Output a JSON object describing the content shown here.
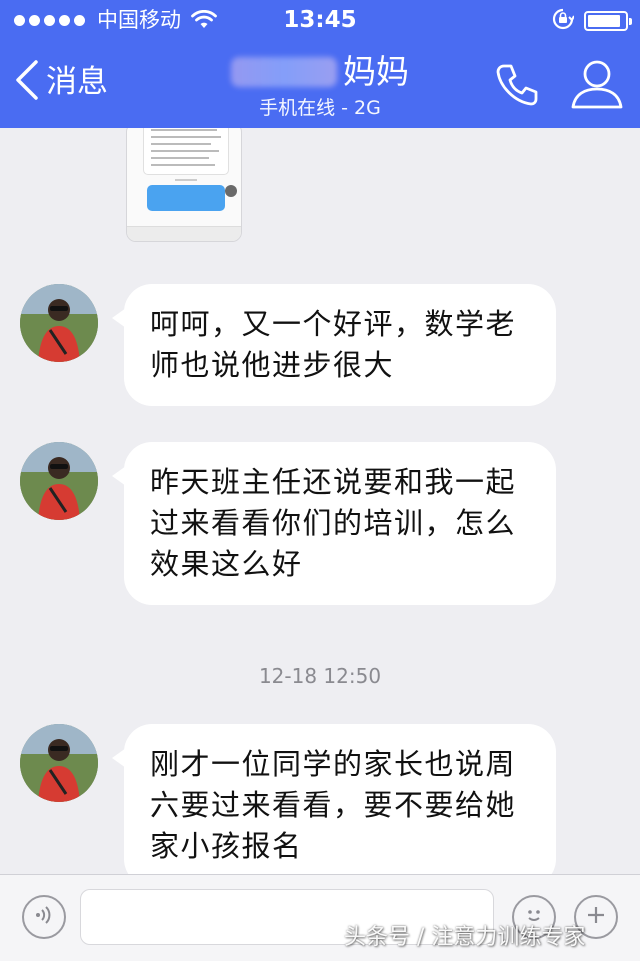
{
  "status_bar": {
    "carrier": "中国移动",
    "time": "13:45",
    "signal_icon": "signal-dots-icon",
    "wifi_icon": "wifi-icon",
    "orientation_icon": "rotation-lock-icon",
    "battery_icon": "battery-icon",
    "battery_level": 0.9
  },
  "nav": {
    "back_label": "消息",
    "back_icon": "chevron-left-icon",
    "contact_name": "妈妈",
    "contact_status": "手机在线 - 2G",
    "phone_icon": "phone-icon",
    "profile_icon": "person-icon"
  },
  "messages": [
    {
      "text": "呵呵，又一个好评，数学老师也说他进步很大"
    },
    {
      "text": "昨天班主任还说要和我一起过来看看你们的培训，怎么效果这么好"
    },
    {
      "text": "刚才一位同学的家长也说周六要过来看看，要不要给她家小孩报名"
    }
  ],
  "timestamp": "12-18 12:50",
  "input_bar": {
    "voice_icon": "voice-icon",
    "input_value": "",
    "emoji_icon": "emoji-icon",
    "add_icon": "plus-icon"
  },
  "watermark": "头条号 / 注意力训练专家",
  "colors": {
    "header": "#4a6cf2",
    "chat_background": "#eeeef2",
    "bubble": "#ffffff"
  }
}
